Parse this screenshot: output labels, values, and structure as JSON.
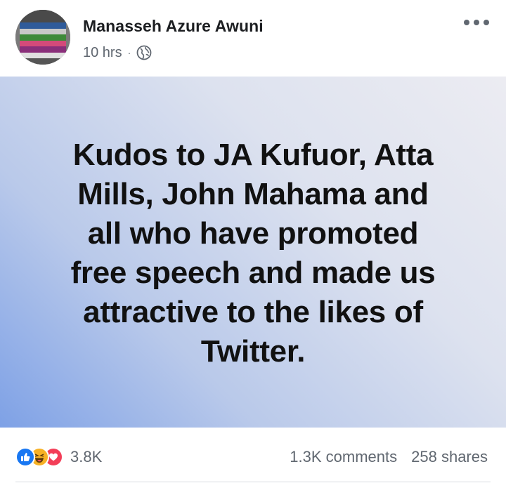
{
  "post": {
    "author": "Manasseh Azure Awuni",
    "time": "10 hrs",
    "separator": "·",
    "privacy_icon": "globe-icon",
    "text": "Kudos to JA Kufuor, Atta\nMills, John Mahama and\nall who have promoted\nfree speech and made us\nattractive to the likes of\nTwitter.",
    "background_colors": [
      "#ececf2",
      "#dde2ef",
      "#b9c9ea",
      "#7ea1e6"
    ]
  },
  "engagement": {
    "reaction_icons": [
      "like-icon",
      "haha-icon",
      "love-icon"
    ],
    "reaction_count": "3.8K",
    "comments": "1.3K comments",
    "shares": "258 shares"
  },
  "colors": {
    "like": "#1877f2",
    "haha": "#f7b125",
    "love": "#f33e58",
    "secondary_text": "#606770"
  }
}
